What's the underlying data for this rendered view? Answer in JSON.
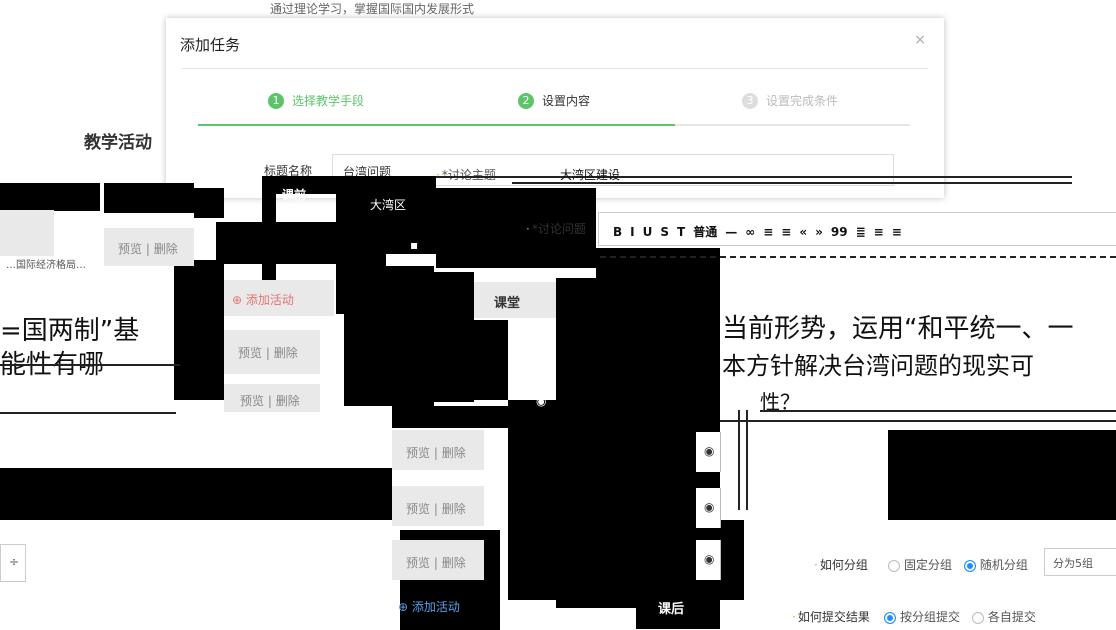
{
  "background": {
    "top_hint": "通过理论学习，掌握国际国内发展形式",
    "section_title": "教学活动"
  },
  "dialog": {
    "title": "添加任务",
    "close": "×",
    "steps": [
      {
        "num": "1",
        "label": "选择教学手段",
        "state": "done"
      },
      {
        "num": "2",
        "label": "设置内容",
        "state": "active"
      },
      {
        "num": "3",
        "label": "设置完成条件",
        "state": "pending"
      }
    ],
    "progress": 0.67,
    "name_label": "标题名称",
    "name_value": "台湾问题",
    "topic_label": "*讨论主题",
    "topic_value": "大湾区建设"
  },
  "left": {
    "breadcrumb": "…国际经济格局…",
    "actions": [
      "预览",
      "删除"
    ],
    "big_text_1": "=国两制”基",
    "big_text_2": "能性有哪",
    "add_activity": "添加活动",
    "rows": [
      {
        "actions": [
          "预览",
          "删除"
        ]
      },
      {
        "actions": [
          "预览",
          "删除"
        ]
      }
    ],
    "select_value": "÷"
  },
  "middle": {
    "col_header": "课前",
    "file_name": "大湾区",
    "classroom": "课堂",
    "rows": [
      {
        "actions": [
          "预览",
          "删除"
        ]
      },
      {
        "actions": [
          "预览",
          "删除"
        ]
      },
      {
        "actions": [
          "预览",
          "删除"
        ]
      }
    ],
    "add_activity": "添加活动",
    "after_class": "课后"
  },
  "editor": {
    "label": "*讨论问题",
    "toolbar": [
      "B",
      "I",
      "U",
      "S",
      "T",
      "普通",
      "—",
      "∞",
      "≡",
      "≡",
      "«",
      "»",
      "99",
      "≣",
      "≡",
      "≡"
    ],
    "text_line_1": "当前形势，运用“和平统一、一",
    "text_line_2": "本方针解决台湾问题的现实可",
    "text_line_3": "性？"
  },
  "settings": {
    "group_label": "如何分组",
    "group_options": [
      {
        "label": "固定分组",
        "selected": false
      },
      {
        "label": "随机分组",
        "selected": true
      }
    ],
    "group_count": "分为5组",
    "submit_label": "如何提交结果",
    "submit_options": [
      {
        "label": "按分组提交",
        "selected": true
      },
      {
        "label": "各自提交",
        "selected": false
      }
    ]
  },
  "colors": {
    "accent_green": "#5cc46a",
    "accent_blue": "#1e90ff",
    "required": "#f0a020"
  }
}
